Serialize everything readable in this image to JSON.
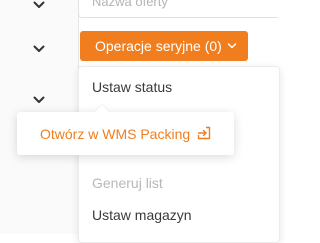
{
  "accent_color": "#f07e1f",
  "search": {
    "placeholder": "Nazwa oferty"
  },
  "serial_button": {
    "label": "Operacje seryjne (0)",
    "icon": "chevron-down-icon"
  },
  "menu": {
    "items": [
      {
        "label": "Ustaw status",
        "enabled": true
      },
      {
        "label": "Generuj list",
        "enabled": false
      },
      {
        "label": "Ustaw magazyn",
        "enabled": true
      }
    ]
  },
  "wms_popup": {
    "label": "Otwórz w WMS Packing",
    "icon": "external-link-icon"
  }
}
